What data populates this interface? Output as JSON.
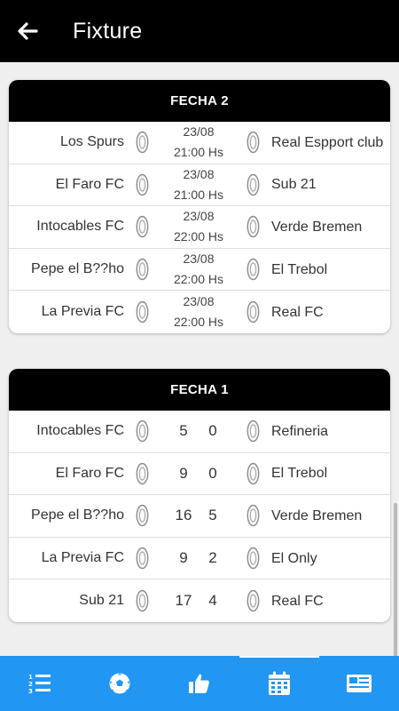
{
  "app_bar": {
    "title": "Fixture",
    "back_icon": "arrow-left-icon"
  },
  "rounds": [
    {
      "title": "FECHA 2",
      "matches": [
        {
          "home": "Los Spurs",
          "away": "Real Espport club",
          "date": "23/08",
          "time": "21:00 Hs"
        },
        {
          "home": "El Faro FC",
          "away": "Sub 21",
          "date": "23/08",
          "time": "21:00 Hs"
        },
        {
          "home": "Intocables FC",
          "away": "Verde Bremen",
          "date": "23/08",
          "time": "22:00 Hs"
        },
        {
          "home": "Pepe el B??ho",
          "away": "El Trebol",
          "date": "23/08",
          "time": "22:00 Hs"
        },
        {
          "home": "La Previa FC",
          "away": "Real FC",
          "date": "23/08",
          "time": "22:00 Hs"
        }
      ]
    },
    {
      "title": "FECHA 1",
      "matches": [
        {
          "home": "Intocables FC",
          "away": "Refineria",
          "home_score": "5",
          "away_score": "0"
        },
        {
          "home": "El Faro FC",
          "away": "El Trebol",
          "home_score": "9",
          "away_score": "0"
        },
        {
          "home": "Pepe el B??ho",
          "away": "Verde Bremen",
          "home_score": "16",
          "away_score": "5"
        },
        {
          "home": "La Previa FC",
          "away": "El Only",
          "home_score": "9",
          "away_score": "2"
        },
        {
          "home": "Sub 21",
          "away": "Real FC",
          "home_score": "17",
          "away_score": "4"
        }
      ]
    }
  ],
  "bottom_nav": {
    "active_index": 3,
    "items": [
      {
        "icon": "ranked-list-icon"
      },
      {
        "icon": "soccer-ball-icon"
      },
      {
        "icon": "thumbs-up-icon"
      },
      {
        "icon": "calendar-icon"
      },
      {
        "icon": "news-icon"
      }
    ]
  },
  "colors": {
    "app_bar": "#000000",
    "bottom_nav": "#2196f3",
    "background": "#efefef",
    "card_header": "#000000"
  }
}
